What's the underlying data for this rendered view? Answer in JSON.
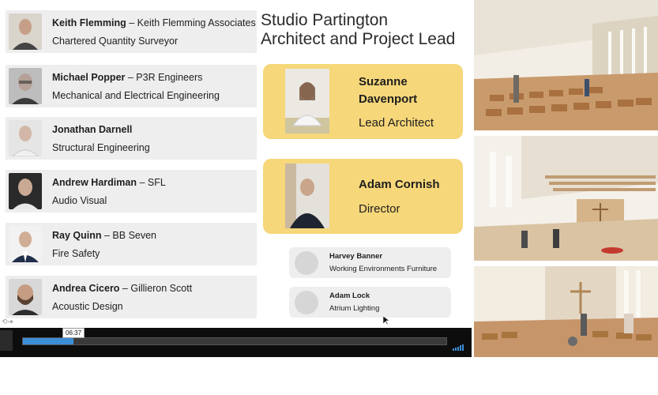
{
  "consultants": [
    {
      "name": "Keith Flemming",
      "company": "Keith Flemming Associates",
      "role": "Chartered Quantity Surveyor"
    },
    {
      "name": "Michael Popper",
      "company": "P3R Engineers",
      "role": "Mechanical and Electrical Engineering"
    },
    {
      "name": "Jonathan Darnell",
      "company": "",
      "role": "Structural Engineering"
    },
    {
      "name": "Andrew Hardiman",
      "company": "SFL",
      "role": "Audio Visual"
    },
    {
      "name": "Ray Quinn",
      "company": "BB Seven",
      "role": "Fire Safety"
    },
    {
      "name": "Andrea Cicero",
      "company": "Gillieron Scott",
      "role": "Acoustic Design"
    }
  ],
  "separator": " – ",
  "studio": {
    "title_line1": "Studio Partington",
    "title_line2": "Architect and Project Lead"
  },
  "leads": [
    {
      "name_line1": "Suzanne",
      "name_line2": "Davenport",
      "role": "Lead Architect"
    },
    {
      "name_line1": "Adam Cornish",
      "name_line2": "",
      "role": "Director"
    }
  ],
  "suppliers": [
    {
      "name": "Harvey Banner",
      "role": "Working Environments Furniture"
    },
    {
      "name": "Adam Lock",
      "role": "Atrium Lighting"
    }
  ],
  "player": {
    "current_time": "06:37",
    "progress": 0.12,
    "volume_level": 1.0,
    "accent_color": "#3d8ed8"
  },
  "colors": {
    "lead_card": "#f6d77a",
    "card": "#eeeeee"
  }
}
